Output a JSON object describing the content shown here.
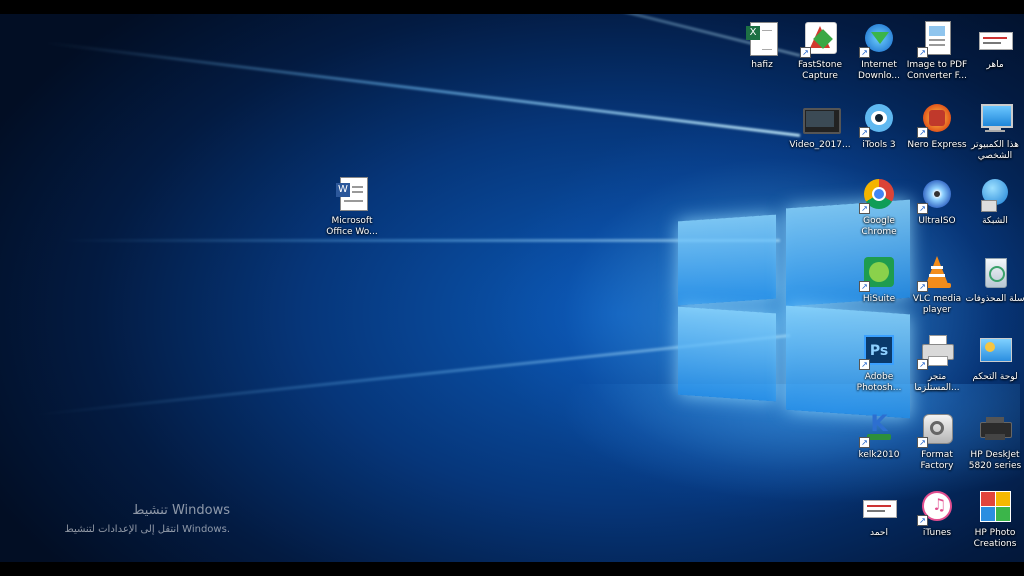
{
  "desktop": {
    "icons": {
      "hafiz": "hafiz",
      "faststone": "FastStone Capture",
      "idm": "Internet Downlo...",
      "image_to_pdf": "Image to PDF Converter F...",
      "maher": "ماهر",
      "video": "Video_2017...",
      "itools": "iTools 3",
      "nero": "Nero Express",
      "this_pc": "هذا الكمبيوتر الشخصي",
      "word": "Microsoft Office Wo...",
      "chrome": "Google Chrome",
      "ultraiso": "UltraISO",
      "network": "الشبكة",
      "hisuite": "HiSuite",
      "vlc": "VLC media player",
      "recycle_bin": "سلة المحذوفات",
      "photoshop": "Adobe Photosh...",
      "printer_store": "متجر المستلزما...",
      "control_panel": "لوحة التحكم",
      "kelk": "kelk2010",
      "format_factory": "Format Factory",
      "hp_deskjet": "HP DeskJet 5820 series",
      "ahmed": "احمد",
      "itunes": "iTunes",
      "hp_photo": "HP Photo Creations"
    },
    "activation": {
      "title": "تنشيط Windows",
      "subtitle": "انتقل إلى الإعدادات لتنشيط Windows."
    }
  },
  "colors": {
    "accent": "#1a8fff",
    "chrome_red": "#db4437",
    "chrome_yellow": "#f4b400",
    "chrome_green": "#0f9d58",
    "photoshop": "#0a3a6b"
  }
}
